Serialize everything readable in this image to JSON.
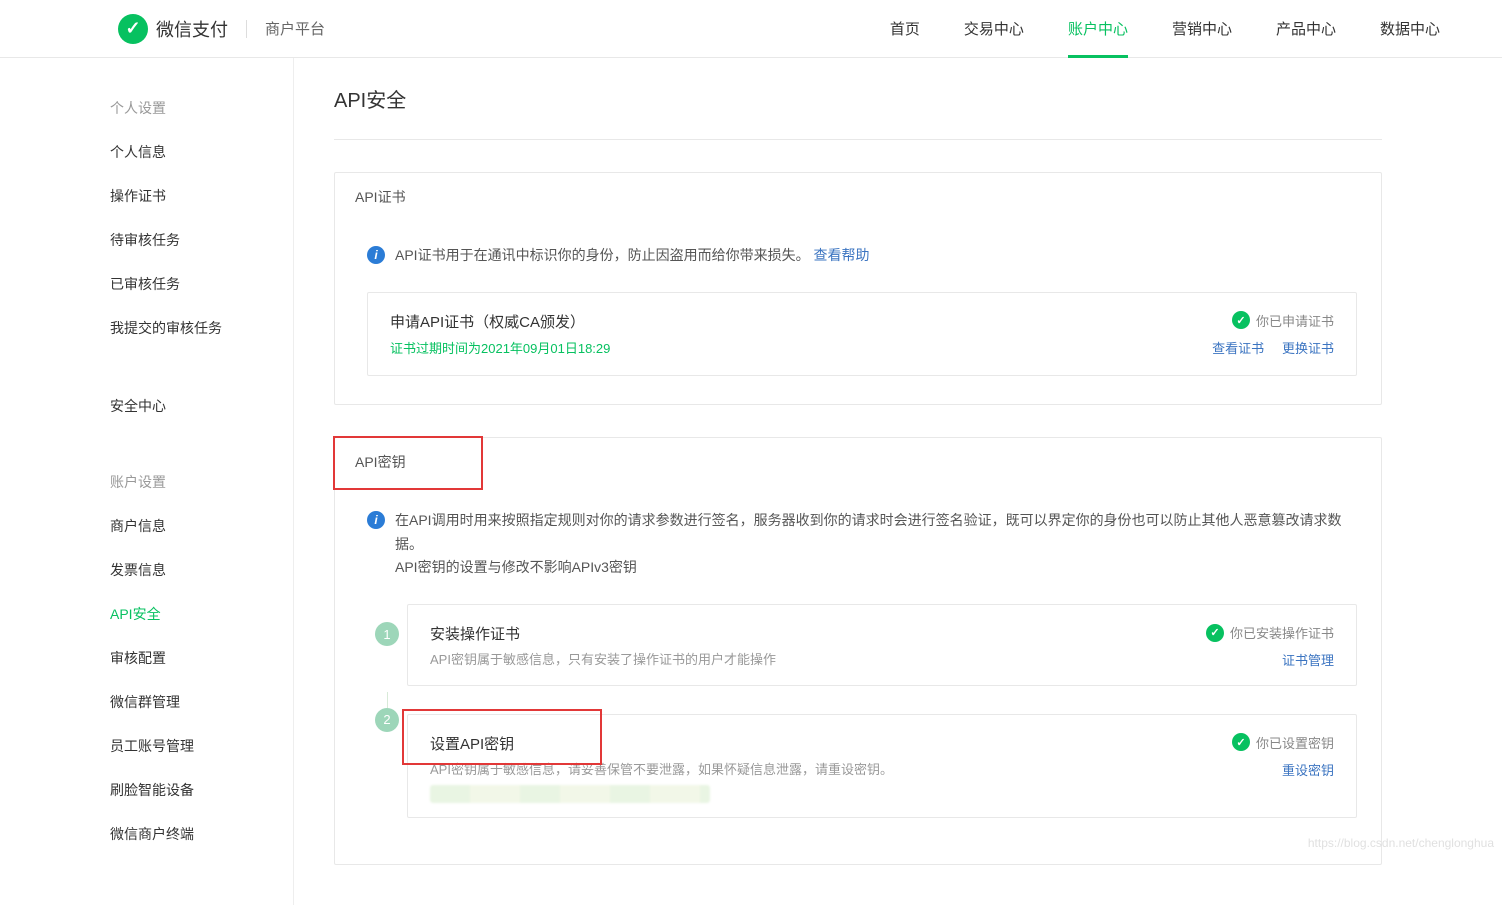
{
  "header": {
    "brand": "微信支付",
    "subtitle": "商户平台",
    "nav": [
      {
        "label": "首页",
        "active": false
      },
      {
        "label": "交易中心",
        "active": false
      },
      {
        "label": "账户中心",
        "active": true
      },
      {
        "label": "营销中心",
        "active": false
      },
      {
        "label": "产品中心",
        "active": false
      },
      {
        "label": "数据中心",
        "active": false
      }
    ]
  },
  "sidebar": {
    "section1_title": "个人设置",
    "section1_items": [
      "个人信息",
      "操作证书",
      "待审核任务",
      "已审核任务",
      "我提交的审核任务"
    ],
    "section_sec_title": "安全中心",
    "section2_title": "账户设置",
    "section2_items": [
      "商户信息",
      "发票信息",
      "API安全",
      "审核配置",
      "微信群管理",
      "员工账号管理",
      "刷脸智能设备",
      "微信商户终端"
    ],
    "active_item": "API安全"
  },
  "page": {
    "title": "API安全"
  },
  "panel_cert": {
    "header": "API证书",
    "info_text": "API证书用于在通讯中标识你的身份，防止因盗用而给你带来损失。",
    "info_link": "查看帮助",
    "card": {
      "title": "申请API证书（权威CA颁发）",
      "sub": "证书过期时间为2021年09月01日18:29",
      "status": "你已申请证书",
      "link1": "查看证书",
      "link2": "更换证书"
    }
  },
  "panel_key": {
    "header": "API密钥",
    "info_line1": "在API调用时用来按照指定规则对你的请求参数进行签名，服务器收到你的请求时会进行签名验证，既可以界定你的身份也可以防止其他人恶意篡改请求数据。",
    "info_line2": "API密钥的设置与修改不影响APIv3密钥",
    "step1": {
      "num": "1",
      "title": "安装操作证书",
      "sub": "API密钥属于敏感信息，只有安装了操作证书的用户才能操作",
      "status": "你已安装操作证书",
      "link": "证书管理"
    },
    "step2": {
      "num": "2",
      "title": "设置API密钥",
      "sub": "API密钥属于敏感信息，请妥善保管不要泄露，如果怀疑信息泄露，请重设密钥。",
      "status": "你已设置密钥",
      "link": "重设密钥"
    }
  },
  "watermark": "https://blog.csdn.net/chenglonghua"
}
